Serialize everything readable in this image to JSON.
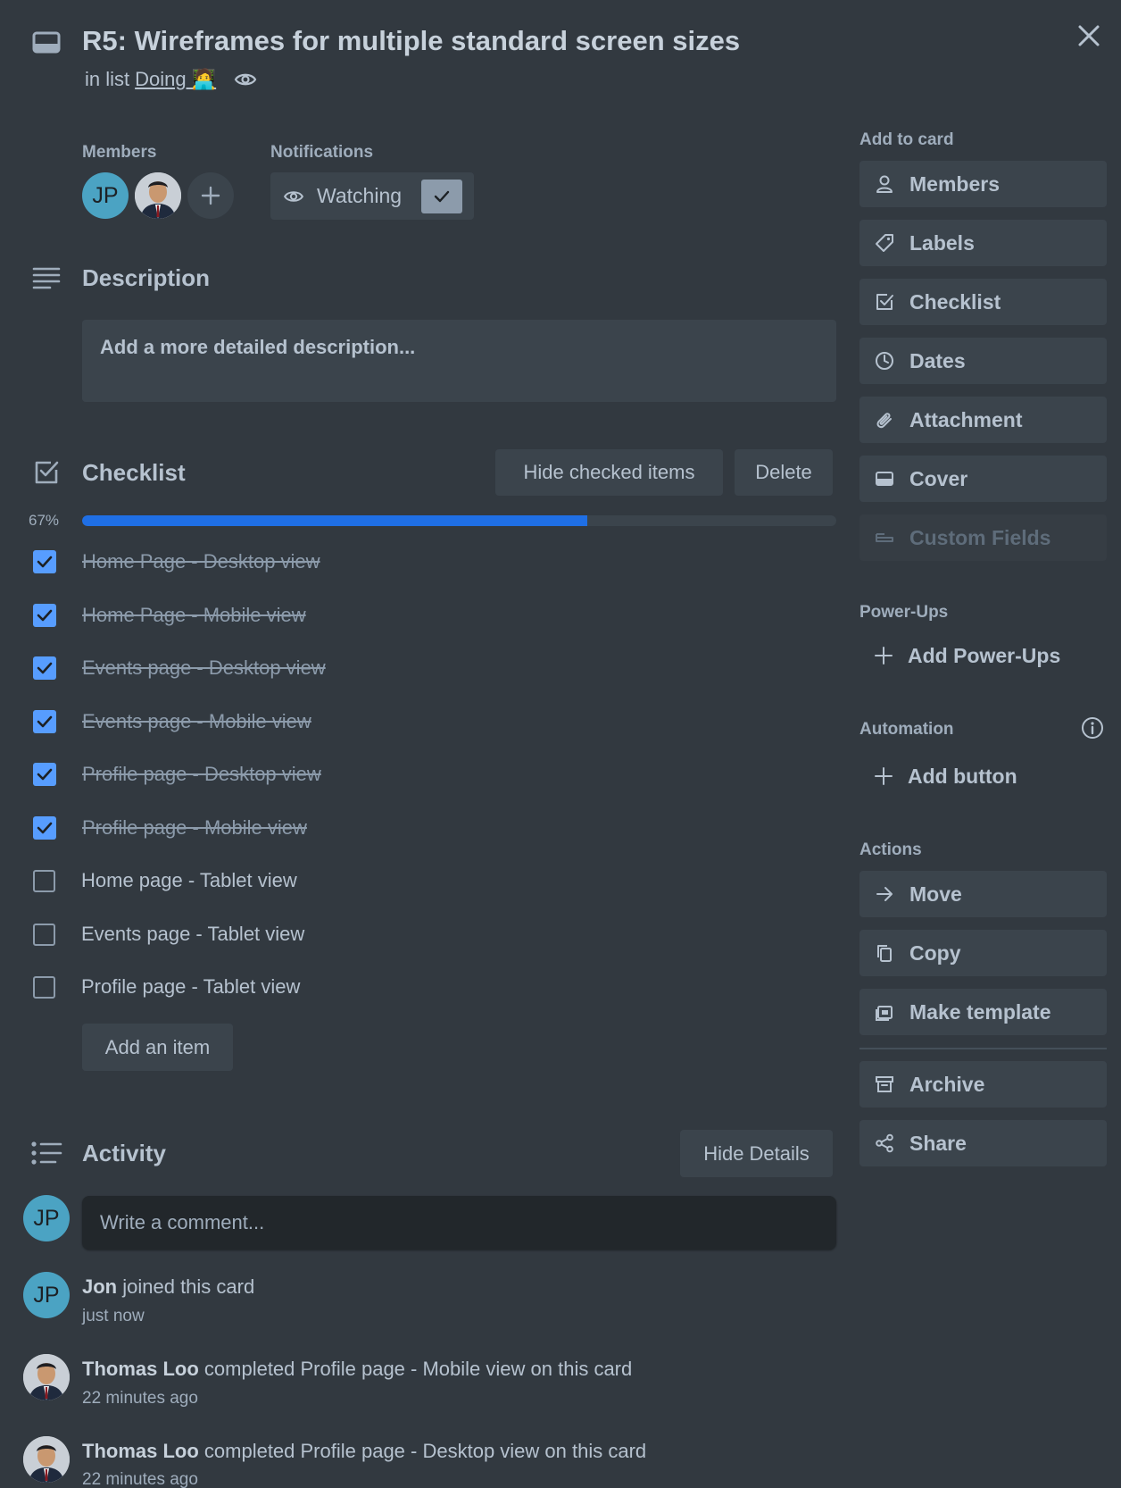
{
  "card": {
    "title": "R5: Wireframes for multiple standard screen sizes",
    "in_list_prefix": "in list",
    "list_name": "Doing 🧑‍💻"
  },
  "members": {
    "label": "Members",
    "initials": "JP"
  },
  "notifications": {
    "label": "Notifications",
    "watching_label": "Watching"
  },
  "description": {
    "title": "Description",
    "placeholder": "Add a more detailed description..."
  },
  "checklist": {
    "title": "Checklist",
    "hide_checked_label": "Hide checked items",
    "delete_label": "Delete",
    "percent_label": "67%",
    "progress": 0.67,
    "items": [
      {
        "text": "Home Page - Desktop view",
        "checked": true
      },
      {
        "text": "Home Page - Mobile view",
        "checked": true
      },
      {
        "text": "Events page - Desktop view",
        "checked": true
      },
      {
        "text": "Events page - Mobile view",
        "checked": true
      },
      {
        "text": "Profile page - Desktop view",
        "checked": true
      },
      {
        "text": "Profile page - Mobile view",
        "checked": true
      },
      {
        "text": "Home page - Tablet view",
        "checked": false
      },
      {
        "text": "Events page - Tablet view",
        "checked": false
      },
      {
        "text": "Profile page - Tablet view",
        "checked": false
      }
    ],
    "add_item_label": "Add an item"
  },
  "activity": {
    "title": "Activity",
    "hide_details_label": "Hide Details",
    "comment_placeholder": "Write a comment...",
    "entries": [
      {
        "initials": "JP",
        "actor": "Jon",
        "action": " joined this card",
        "time": "just now"
      },
      {
        "actor": "Thomas Loo",
        "action": " completed Profile page - Mobile view on this card",
        "time": "22 minutes ago"
      },
      {
        "actor": "Thomas Loo",
        "action": " completed Profile page - Desktop view on this card",
        "time": "22 minutes ago"
      }
    ]
  },
  "sidebar": {
    "add_to_card_label": "Add to card",
    "add_to_card": [
      {
        "label": "Members",
        "icon": "person-icon"
      },
      {
        "label": "Labels",
        "icon": "tag-icon"
      },
      {
        "label": "Checklist",
        "icon": "checkbox-icon"
      },
      {
        "label": "Dates",
        "icon": "clock-icon"
      },
      {
        "label": "Attachment",
        "icon": "paperclip-icon"
      },
      {
        "label": "Cover",
        "icon": "cover-icon"
      },
      {
        "label": "Custom Fields",
        "icon": "custom-fields-icon",
        "disabled": true
      }
    ],
    "powerups_label": "Power-Ups",
    "add_powerups_label": "Add Power-Ups",
    "automation_label": "Automation",
    "add_button_label": "Add button",
    "actions_label": "Actions",
    "actions": [
      {
        "label": "Move",
        "icon": "arrow-right-icon"
      },
      {
        "label": "Copy",
        "icon": "copy-icon"
      },
      {
        "label": "Make template",
        "icon": "template-icon"
      },
      {
        "label": "Archive",
        "icon": "archive-icon"
      },
      {
        "label": "Share",
        "icon": "share-icon"
      }
    ]
  },
  "colors": {
    "background": "#323940",
    "button": "#3b444c",
    "progress": "#1f6fe5",
    "checkbox": "#579dff",
    "avatar": "#4ba3c3"
  }
}
